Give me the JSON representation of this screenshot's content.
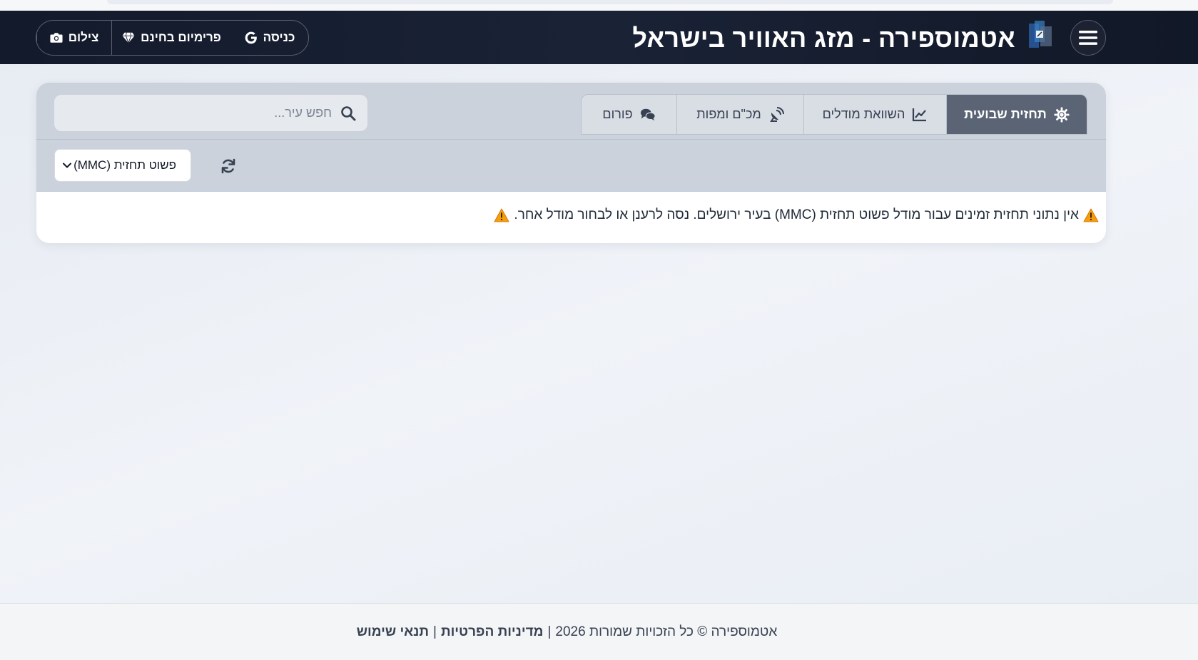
{
  "header": {
    "title": "אטמוספירה - מזג האוויר בישראל",
    "buttons": {
      "camera_label": "צילום",
      "premium_label": "פרימיום בחינם",
      "login_label": "כניסה"
    }
  },
  "tabs": [
    {
      "label": "תחזית שבועית",
      "icon": "gear-sun-icon",
      "active": true
    },
    {
      "label": "השוואת מודלים",
      "icon": "line-chart-icon",
      "active": false
    },
    {
      "label": "מכ\"ם ומפות",
      "icon": "satellite-dish-icon",
      "active": false
    },
    {
      "label": "פורום",
      "icon": "comments-icon",
      "active": false
    }
  ],
  "search": {
    "placeholder": "חפש עיר..."
  },
  "model_select": {
    "selected": "פשוט תחזית (MMC)"
  },
  "message": {
    "text": "אין נתוני תחזית זמינים עבור מודל פשוט תחזית (MMC) בעיר ירושלים. נסה לרענן או לבחור מודל אחר."
  },
  "footer": {
    "copyright": "אטמוספירה © כל הזכויות שמורות 2026",
    "separator": "|",
    "privacy_label": "מדיניות הפרטיות",
    "terms_label": "תנאי שימוש"
  },
  "colors": {
    "header_bg": "#121a2b",
    "active_tab": "#5b6475",
    "panel_top": "#cbd2db",
    "warning": "#f59e0b"
  }
}
